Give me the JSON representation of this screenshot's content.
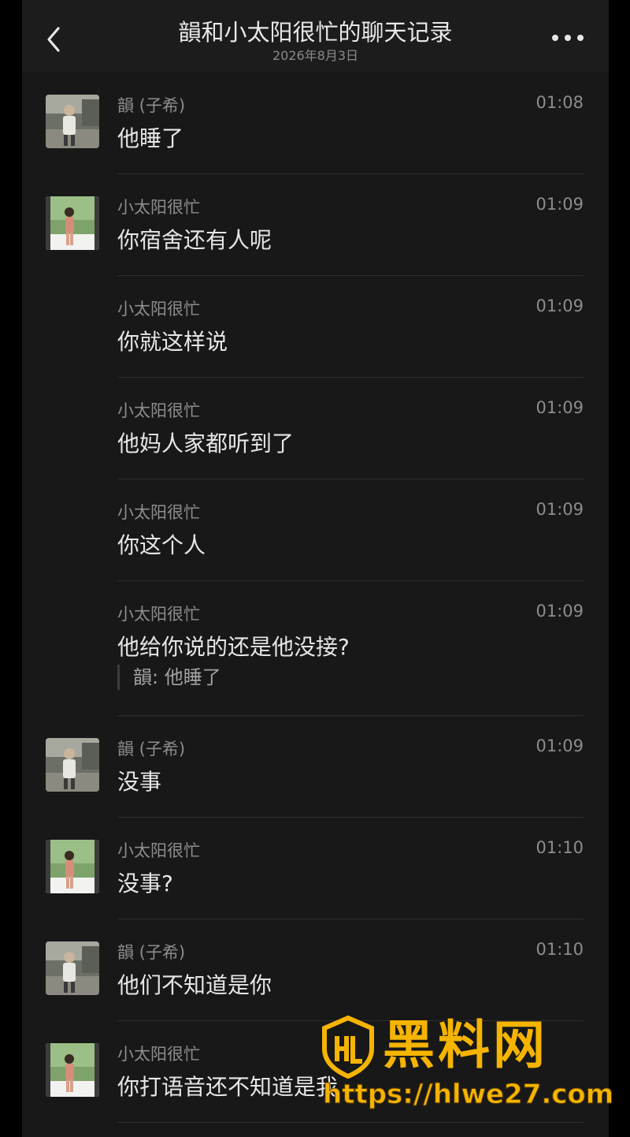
{
  "header": {
    "title": "韻和小太阳很忙的聊天记录",
    "date": "2026年8月3日",
    "back_icon": "chevron-left-icon",
    "more_icon": "more-dots-icon"
  },
  "messages": [
    {
      "sender": "韻 (子希)",
      "time": "01:08",
      "text": "他睡了",
      "avatar": "man"
    },
    {
      "sender": "小太阳很忙",
      "time": "01:09",
      "text": "你宿舍还有人呢",
      "avatar": "woman"
    },
    {
      "sender": "小太阳很忙",
      "time": "01:09",
      "text": "你就这样说"
    },
    {
      "sender": "小太阳很忙",
      "time": "01:09",
      "text": "他妈人家都听到了"
    },
    {
      "sender": "小太阳很忙",
      "time": "01:09",
      "text": "你这个人"
    },
    {
      "sender": "小太阳很忙",
      "time": "01:09",
      "text": "他给你说的还是他没接?",
      "quote": "韻:  他睡了"
    },
    {
      "sender": "韻 (子希)",
      "time": "01:09",
      "text": "没事",
      "avatar": "man"
    },
    {
      "sender": "小太阳很忙",
      "time": "01:10",
      "text": "没事?",
      "avatar": "woman"
    },
    {
      "sender": "韻 (子希)",
      "time": "01:10",
      "text": "他们不知道是你",
      "avatar": "man"
    },
    {
      "sender": "小太阳很忙",
      "time": "",
      "text": "你打语音还不知道是我",
      "avatar": "woman"
    }
  ],
  "watermark": {
    "title": "黑料网",
    "url": "https://hlwe27.com",
    "color": "#f5b400"
  }
}
